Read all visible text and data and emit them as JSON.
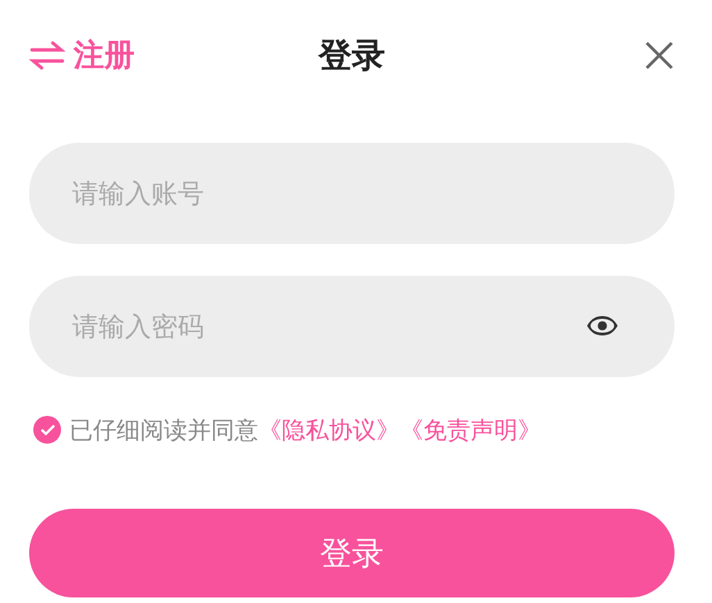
{
  "header": {
    "switch_label": "注册",
    "title": "登录"
  },
  "fields": [
    {
      "placeholder": "请输入账号",
      "kind": "text"
    },
    {
      "placeholder": "请输入密码",
      "kind": "password"
    }
  ],
  "agreement": {
    "checked": true,
    "text": "已仔细阅读并同意",
    "links": [
      "《隐私协议》",
      "《免责声明》"
    ]
  },
  "submit": "登录"
}
